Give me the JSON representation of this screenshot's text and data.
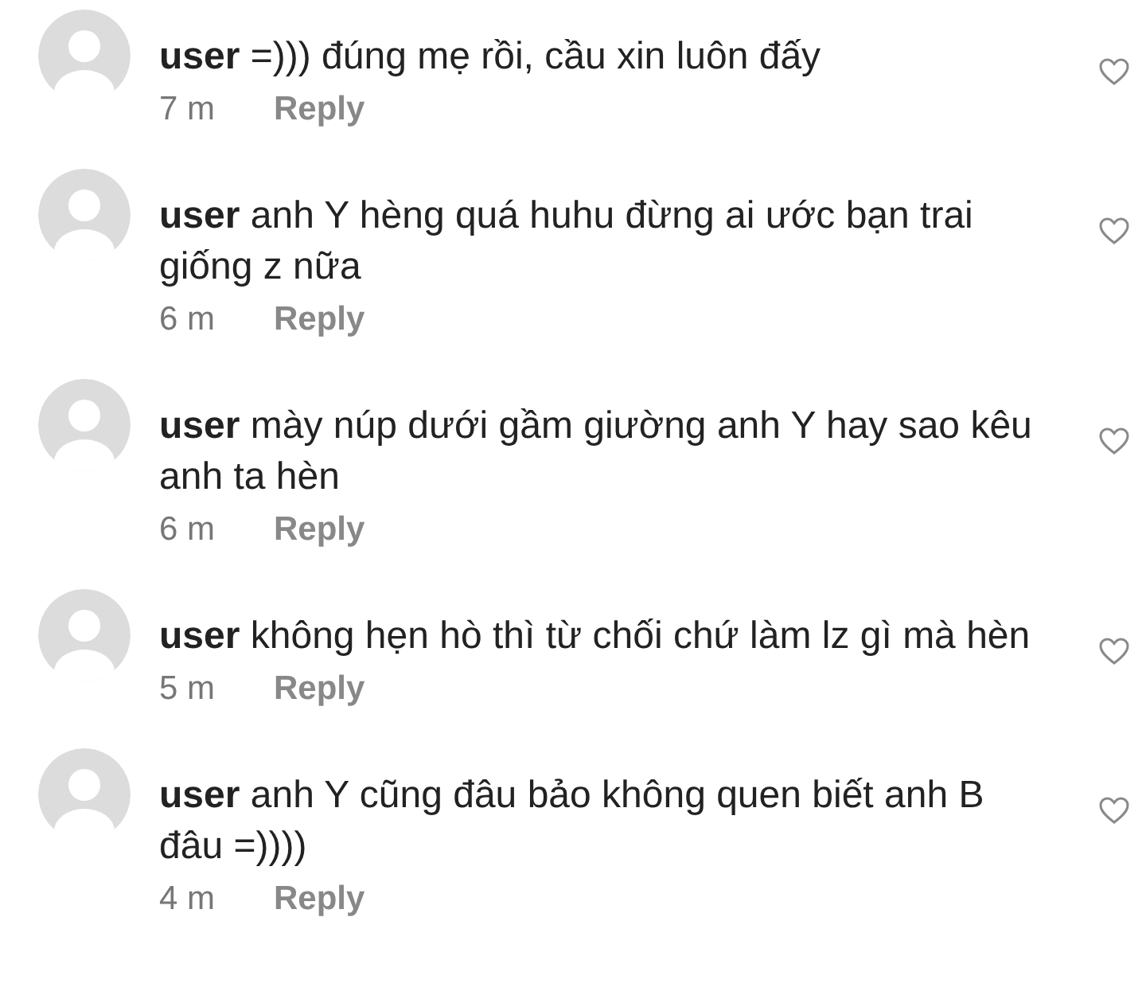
{
  "comments": [
    {
      "username": "user",
      "text": "=))) đúng mẹ rồi, cầu xin luôn đấy",
      "time": "7 m",
      "reply": "Reply",
      "liked": false
    },
    {
      "username": "user",
      "text": "anh Y hèng quá huhu đừng ai ước bạn trai giống z nữa",
      "time": "6 m",
      "reply": "Reply",
      "liked": false
    },
    {
      "username": "user",
      "text": "mày núp dưới gầm giường anh Y hay sao kêu anh ta hèn",
      "time": "6 m",
      "reply": "Reply",
      "liked": false
    },
    {
      "username": "user",
      "text": "không hẹn hò thì từ chối chứ làm lz gì mà hèn",
      "time": "5 m",
      "reply": "Reply",
      "liked": false
    },
    {
      "username": "user",
      "text": "anh Y cũng đâu bảo không quen biết anh B đâu =))))",
      "time": "4 m",
      "reply": "Reply",
      "liked": false
    }
  ]
}
